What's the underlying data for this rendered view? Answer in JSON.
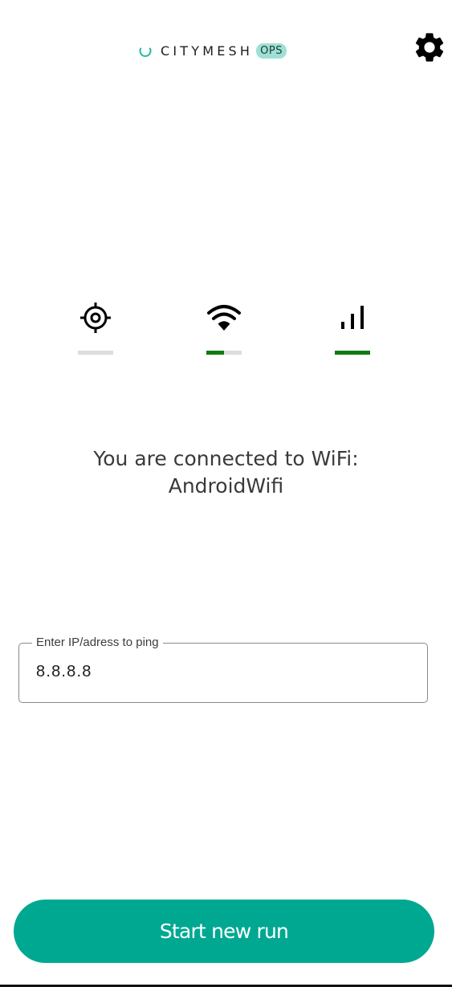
{
  "header": {
    "brand_name": "CITYMESH",
    "brand_badge": "OPS",
    "brand_color": "#00a892",
    "settings_icon": "gear-icon"
  },
  "status_indicators": [
    {
      "name": "location",
      "icon": "gps-target-icon",
      "level": 0.0
    },
    {
      "name": "wifi",
      "icon": "wifi-icon",
      "level": 0.5
    },
    {
      "name": "cellular",
      "icon": "signal-bars-icon",
      "level": 1.0
    }
  ],
  "status_colors": {
    "filled": "#137a13",
    "empty": "#dddddd"
  },
  "message": {
    "line1": "You are connected to WiFi:",
    "line2": "AndroidWifi"
  },
  "ping_field": {
    "label": "Enter IP/adress to ping",
    "value": "8.8.8.8"
  },
  "primary_action": {
    "label": "Start new run",
    "color": "#00a892"
  }
}
